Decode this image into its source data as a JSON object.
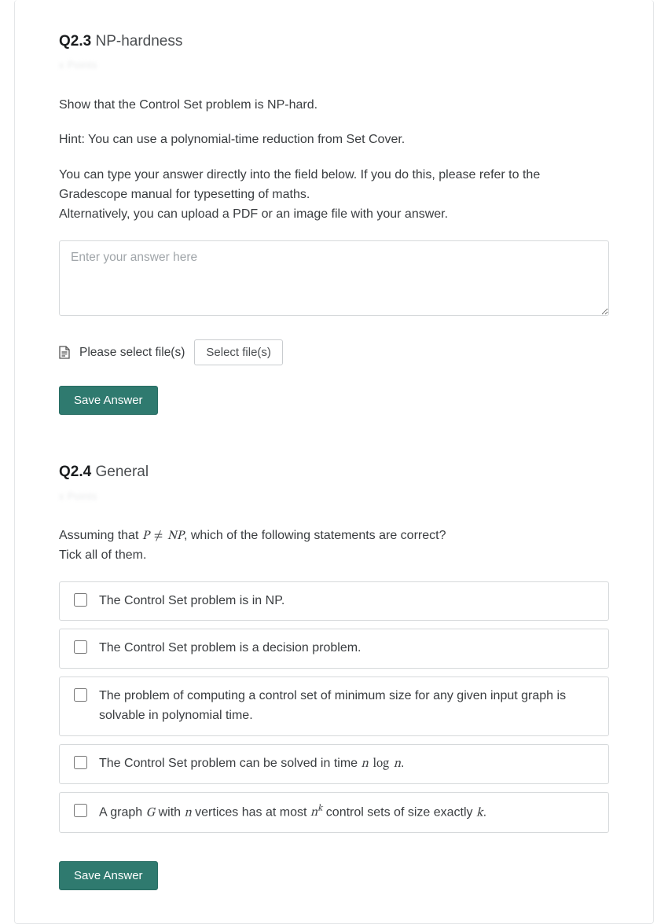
{
  "q23": {
    "number": "Q2.3",
    "title": "NP-hardness",
    "points_placeholder": "x Points",
    "para1": "Show that the Control Set problem is NP-hard.",
    "para2": "Hint: You can use a polynomial-time reduction from Set Cover.",
    "para3": "You can type your answer directly into the field below. If you do this, please refer to the Gradescope manual for typesetting of maths.",
    "para4": "Alternatively, you can upload a PDF or an image file with your answer.",
    "answer_placeholder": "Enter your answer here",
    "file_label": "Please select file(s)",
    "select_files": "Select file(s)",
    "save": "Save Answer"
  },
  "q24": {
    "number": "Q2.4",
    "title": "General",
    "points_placeholder": "x Points",
    "intro_pre": "Assuming that ",
    "math_expr_html": "<span class=\"math\">P <span class=\"op\">≠</span> NP</span>",
    "intro_post": ", which of the following statements are correct?",
    "intro_line2": "Tick all of them.",
    "options": [
      "The Control Set problem is in NP.",
      "The Control Set problem is a decision problem.",
      "The problem of computing a control set of minimum size for any given input graph is solvable in polynomial time.",
      "The Control Set problem can be solved in time <span class=\"math\">n <span class=\"op\">log</span> n</span>.",
      "A graph <span class=\"math\">G</span> with <span class=\"math\">n</span> vertices has at most <span class=\"math\">n<span class=\"sup\">k</span></span> control sets of size exactly <span class=\"math\">k</span>."
    ],
    "save": "Save Answer"
  }
}
